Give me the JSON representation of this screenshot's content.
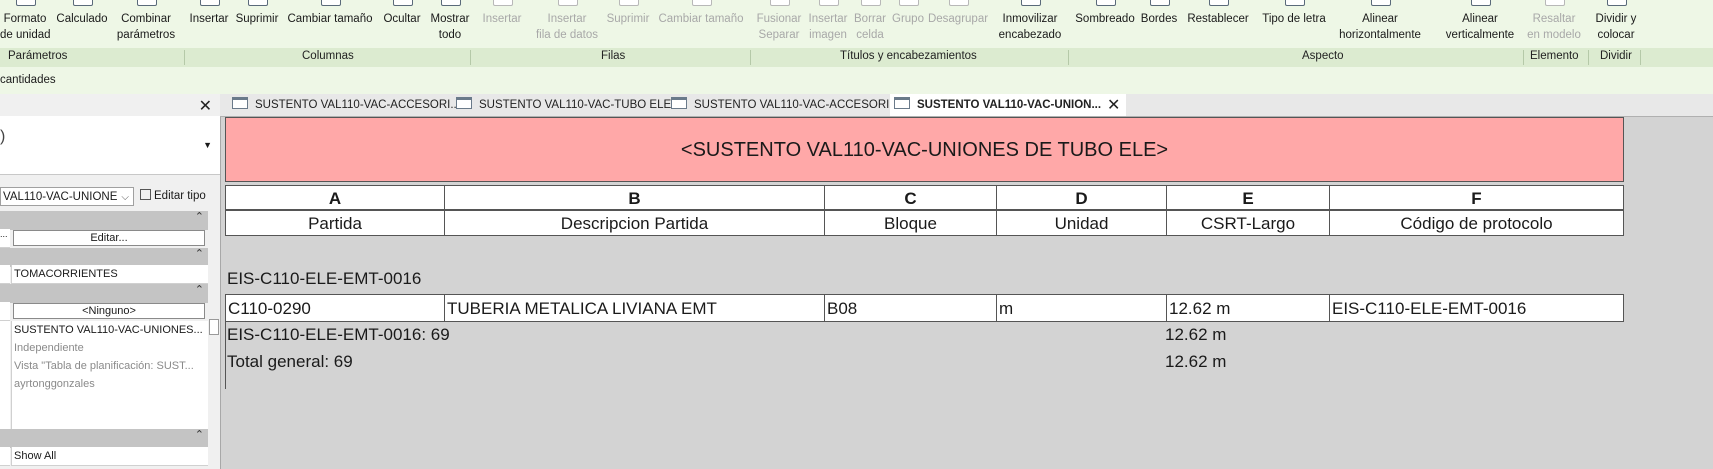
{
  "ribbon": {
    "buttons": [
      {
        "line1": "Formato",
        "line2": "de unidad",
        "disabled": false
      },
      {
        "line1": "Calculado",
        "line2": "",
        "disabled": false
      },
      {
        "line1": "Combinar",
        "line2": "parámetros",
        "disabled": false
      },
      {
        "line1": "Insertar",
        "line2": "",
        "disabled": false
      },
      {
        "line1": "Suprimir",
        "line2": "",
        "disabled": false
      },
      {
        "line1": "Cambiar tamaño",
        "line2": "",
        "disabled": false
      },
      {
        "line1": "Ocultar",
        "line2": "",
        "disabled": false
      },
      {
        "line1": "Mostrar",
        "line2": "todo",
        "disabled": false
      },
      {
        "line1": "Insertar",
        "line2": "",
        "disabled": true
      },
      {
        "line1": "Insertar",
        "line2": "fila de datos",
        "disabled": true
      },
      {
        "line1": "Suprimir",
        "line2": "",
        "disabled": true
      },
      {
        "line1": "Cambiar tamaño",
        "line2": "",
        "disabled": true
      },
      {
        "line1": "Fusionar",
        "line2": "Separar",
        "disabled": true
      },
      {
        "line1": "Insertar",
        "line2": "imagen",
        "disabled": true
      },
      {
        "line1": "Borrar",
        "line2": "celda",
        "disabled": true
      },
      {
        "line1": "Grupo",
        "line2": "",
        "disabled": true
      },
      {
        "line1": "Desagrupar",
        "line2": "",
        "disabled": true
      },
      {
        "line1": "Inmovilizar",
        "line2": "encabezado",
        "disabled": false
      },
      {
        "line1": "Sombreado",
        "line2": "",
        "disabled": false
      },
      {
        "line1": "Bordes",
        "line2": "",
        "disabled": false
      },
      {
        "line1": "Restablecer",
        "line2": "",
        "disabled": false
      },
      {
        "line1": "Tipo de letra",
        "line2": "",
        "disabled": false
      },
      {
        "line1": "Alinear",
        "line2": "horizontalmente",
        "disabled": false
      },
      {
        "line1": "Alinear",
        "line2": "verticalmente",
        "disabled": false
      },
      {
        "line1": "Resaltar",
        "line2": "en modelo",
        "disabled": true
      },
      {
        "line1": "Dividir y",
        "line2": "colocar",
        "disabled": false
      }
    ],
    "panels": [
      "Parámetros",
      "Columnas",
      "Filas",
      "Títulos y encabezamientos",
      "Aspecto",
      "Elemento",
      "Dividir"
    ]
  },
  "context_label": "cantidades",
  "properties": {
    "type_selector": "VAL110-VAC-UNIONE",
    "edit_type": "Editar tipo",
    "rows": [
      {
        "kind": "cat"
      },
      {
        "kind": "button",
        "label": "Editar...",
        "left": "..."
      },
      {
        "kind": "cat"
      },
      {
        "kind": "value",
        "value": "TOMACORRIENTES",
        "gray": false
      },
      {
        "kind": "cat"
      },
      {
        "kind": "button",
        "label": "<Ninguno>",
        "left": ""
      },
      {
        "kind": "value",
        "value": "SUSTENTO VAL110-VAC-UNIONES...",
        "gray": false
      },
      {
        "kind": "value",
        "value": "Independiente",
        "gray": true
      },
      {
        "kind": "value",
        "value": "Vista \"Tabla de planificación: SUST...",
        "gray": true
      },
      {
        "kind": "value",
        "value": "ayrtonggonzales",
        "gray": true
      },
      {
        "kind": "value",
        "value": "",
        "gray": false
      },
      {
        "kind": "value",
        "value": "",
        "gray": false
      },
      {
        "kind": "cat"
      },
      {
        "kind": "value",
        "value": "Show All",
        "gray": false
      }
    ]
  },
  "tabs": [
    {
      "label": "SUSTENTO VAL110-VAC-ACCESORI...",
      "active": false
    },
    {
      "label": "SUSTENTO VAL110-VAC-TUBO ELE",
      "active": false
    },
    {
      "label": "SUSTENTO VAL110-VAC-ACCESORI...",
      "active": false
    },
    {
      "label": "SUSTENTO VAL110-VAC-UNION...",
      "active": true
    }
  ],
  "schedule": {
    "title": "<SUSTENTO VAL110-VAC-UNIONES DE TUBO ELE>",
    "letters": [
      "A",
      "B",
      "C",
      "D",
      "E",
      "F"
    ],
    "headers": [
      "Partida",
      "Descripcion Partida",
      "Bloque",
      "Unidad",
      "CSRT-Largo",
      "Código de protocolo"
    ],
    "group_header": "EIS-C110-ELE-EMT-0016",
    "row": [
      "C110-0290",
      "TUBERIA METALICA LIVIANA EMT",
      "B08",
      "m",
      "12.62 m",
      "EIS-C110-ELE-EMT-0016"
    ],
    "group_total_label": "EIS-C110-ELE-EMT-0016: 69",
    "group_total_value": "12.62 m",
    "grand_total_label": "Total general: 69",
    "grand_total_value": "12.62 m"
  }
}
